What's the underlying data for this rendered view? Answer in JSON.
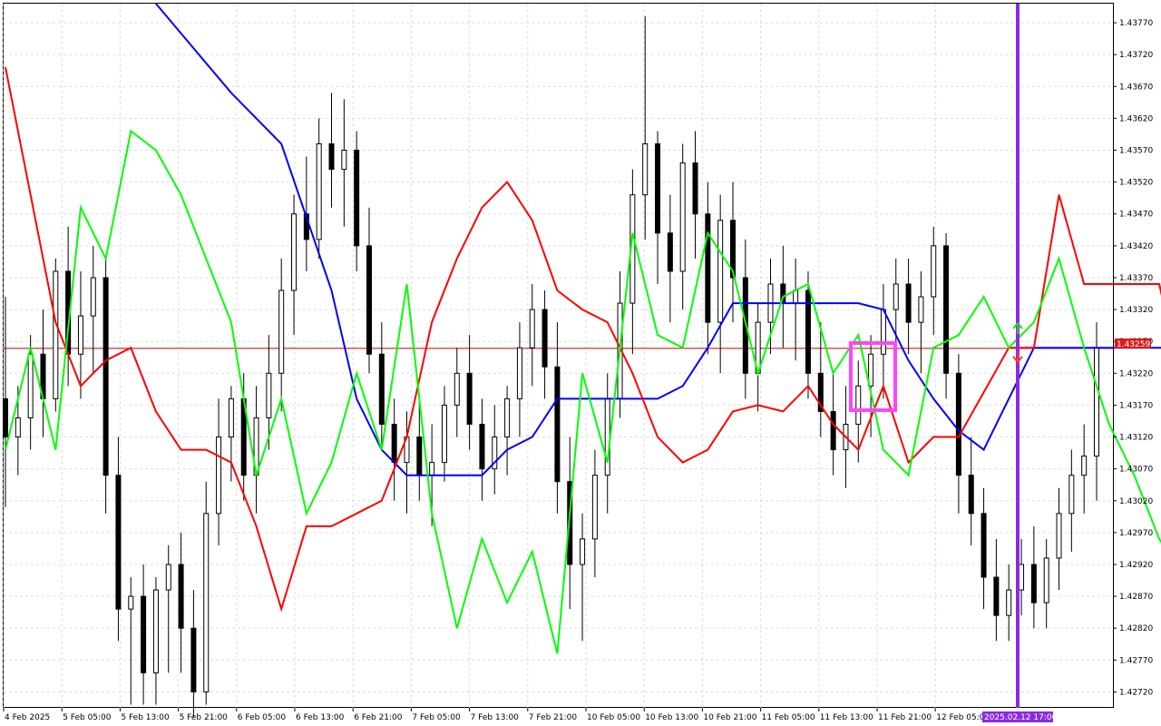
{
  "chart_data": {
    "type": "candlestick",
    "symbol_note": "",
    "y_axis": {
      "ticks": [
        "1.43770",
        "1.43720",
        "1.43670",
        "1.43620",
        "1.43570",
        "1.43520",
        "1.43470",
        "1.43420",
        "1.43370",
        "1.43320",
        "1.43270",
        "1.43220",
        "1.43170",
        "1.43120",
        "1.43070",
        "1.43020",
        "1.42970",
        "1.42920",
        "1.42870",
        "1.42820",
        "1.42770",
        "1.42720"
      ],
      "min": 1.42695,
      "max": 1.438
    },
    "x_axis": {
      "ticks": [
        "4 Feb 2025",
        "5 Feb 05:00",
        "5 Feb 13:00",
        "5 Feb 21:00",
        "6 Feb 05:00",
        "6 Feb 13:00",
        "6 Feb 21:00",
        "7 Feb 05:00",
        "7 Feb 13:00",
        "7 Feb 21:00",
        "10 Feb 05:00",
        "10 Feb 13:00",
        "10 Feb 21:00",
        "11 Feb 05:00",
        "11 Feb 13:00",
        "11 Feb 21:00",
        "12 Feb 05:00"
      ],
      "cursor_label": "2025.02.12 17:00"
    },
    "current_price": {
      "value": 1.43259,
      "label": "1.43259"
    },
    "candles": [
      [
        1.4318,
        1.4334,
        1.4301,
        1.4312
      ],
      [
        1.4312,
        1.432,
        1.4306,
        1.4315
      ],
      [
        1.4315,
        1.4328,
        1.431,
        1.4325
      ],
      [
        1.4325,
        1.4332,
        1.4312,
        1.4318
      ],
      [
        1.4318,
        1.434,
        1.4316,
        1.4338
      ],
      [
        1.4338,
        1.4345,
        1.432,
        1.4325
      ],
      [
        1.4325,
        1.4338,
        1.4318,
        1.4331
      ],
      [
        1.4331,
        1.4342,
        1.4322,
        1.4337
      ],
      [
        1.4337,
        1.434,
        1.43,
        1.4306
      ],
      [
        1.4306,
        1.4312,
        1.428,
        1.4285
      ],
      [
        1.4285,
        1.429,
        1.427,
        1.4287
      ],
      [
        1.4287,
        1.4292,
        1.427,
        1.4275
      ],
      [
        1.4275,
        1.429,
        1.427,
        1.4288
      ],
      [
        1.4288,
        1.4295,
        1.4275,
        1.4292
      ],
      [
        1.4292,
        1.4297,
        1.4275,
        1.4282
      ],
      [
        1.4282,
        1.4288,
        1.4268,
        1.4272
      ],
      [
        1.4272,
        1.4305,
        1.427,
        1.43
      ],
      [
        1.43,
        1.4318,
        1.4295,
        1.4312
      ],
      [
        1.4312,
        1.432,
        1.4305,
        1.4318
      ],
      [
        1.4318,
        1.4322,
        1.4302,
        1.4306
      ],
      [
        1.4306,
        1.432,
        1.43,
        1.4315
      ],
      [
        1.4315,
        1.4328,
        1.431,
        1.4322
      ],
      [
        1.4322,
        1.434,
        1.4316,
        1.4335
      ],
      [
        1.4335,
        1.435,
        1.4328,
        1.4347
      ],
      [
        1.4347,
        1.4356,
        1.4338,
        1.4343
      ],
      [
        1.4343,
        1.4362,
        1.434,
        1.4358
      ],
      [
        1.4358,
        1.4366,
        1.4348,
        1.4354
      ],
      [
        1.4354,
        1.4365,
        1.4345,
        1.4357
      ],
      [
        1.4357,
        1.436,
        1.4338,
        1.4342
      ],
      [
        1.4342,
        1.4348,
        1.4322,
        1.4325
      ],
      [
        1.4325,
        1.433,
        1.431,
        1.4314
      ],
      [
        1.4314,
        1.4318,
        1.4302,
        1.4308
      ],
      [
        1.4308,
        1.4316,
        1.43,
        1.4312
      ],
      [
        1.4312,
        1.4318,
        1.4302,
        1.4306
      ],
      [
        1.4306,
        1.4314,
        1.4298,
        1.4308
      ],
      [
        1.4308,
        1.432,
        1.4305,
        1.4317
      ],
      [
        1.4317,
        1.4326,
        1.4312,
        1.4322
      ],
      [
        1.4322,
        1.4328,
        1.431,
        1.4314
      ],
      [
        1.4314,
        1.4318,
        1.4302,
        1.4307
      ],
      [
        1.4307,
        1.4317,
        1.4303,
        1.4312
      ],
      [
        1.4312,
        1.432,
        1.4306,
        1.4318
      ],
      [
        1.4318,
        1.433,
        1.4312,
        1.4326
      ],
      [
        1.4326,
        1.4336,
        1.432,
        1.4332
      ],
      [
        1.4332,
        1.4335,
        1.4318,
        1.4323
      ],
      [
        1.4323,
        1.433,
        1.43,
        1.4305
      ],
      [
        1.4305,
        1.4312,
        1.4285,
        1.4292
      ],
      [
        1.4292,
        1.43,
        1.428,
        1.4296
      ],
      [
        1.4296,
        1.431,
        1.429,
        1.4306
      ],
      [
        1.4306,
        1.4322,
        1.43,
        1.4318
      ],
      [
        1.4318,
        1.4338,
        1.4315,
        1.4333
      ],
      [
        1.4333,
        1.4354,
        1.4325,
        1.435
      ],
      [
        1.435,
        1.4378,
        1.4343,
        1.4358
      ],
      [
        1.4358,
        1.436,
        1.4336,
        1.4344
      ],
      [
        1.4344,
        1.435,
        1.433,
        1.4338
      ],
      [
        1.4338,
        1.4358,
        1.4332,
        1.4355
      ],
      [
        1.4355,
        1.436,
        1.434,
        1.4347
      ],
      [
        1.4347,
        1.4352,
        1.4325,
        1.433
      ],
      [
        1.433,
        1.435,
        1.4322,
        1.4346
      ],
      [
        1.4346,
        1.4352,
        1.433,
        1.4337
      ],
      [
        1.4337,
        1.4343,
        1.4318,
        1.4322
      ],
      [
        1.4322,
        1.4333,
        1.4316,
        1.433
      ],
      [
        1.433,
        1.434,
        1.4325,
        1.4336
      ],
      [
        1.4336,
        1.4342,
        1.4326,
        1.4333
      ],
      [
        1.4333,
        1.434,
        1.4324,
        1.4335
      ],
      [
        1.4335,
        1.4338,
        1.4318,
        1.4322
      ],
      [
        1.4322,
        1.433,
        1.4312,
        1.4316
      ],
      [
        1.4316,
        1.4322,
        1.4306,
        1.431
      ],
      [
        1.431,
        1.432,
        1.4304,
        1.4314
      ],
      [
        1.4314,
        1.4324,
        1.4308,
        1.432
      ],
      [
        1.432,
        1.4328,
        1.4312,
        1.4325
      ],
      [
        1.4325,
        1.4336,
        1.4318,
        1.4332
      ],
      [
        1.4332,
        1.434,
        1.4326,
        1.4336
      ],
      [
        1.4336,
        1.434,
        1.4325,
        1.433
      ],
      [
        1.433,
        1.4338,
        1.4322,
        1.4334
      ],
      [
        1.4334,
        1.4345,
        1.4328,
        1.4342
      ],
      [
        1.4342,
        1.4344,
        1.4318,
        1.4322
      ],
      [
        1.4322,
        1.4325,
        1.43,
        1.4306
      ],
      [
        1.4306,
        1.4312,
        1.4295,
        1.43
      ],
      [
        1.43,
        1.4304,
        1.4285,
        1.429
      ],
      [
        1.429,
        1.4296,
        1.428,
        1.4284
      ],
      [
        1.4284,
        1.4292,
        1.428,
        1.4288
      ],
      [
        1.4288,
        1.4296,
        1.4284,
        1.4292
      ],
      [
        1.4292,
        1.4298,
        1.4282,
        1.4286
      ],
      [
        1.4286,
        1.4296,
        1.4282,
        1.4293
      ],
      [
        1.4293,
        1.4304,
        1.4288,
        1.43
      ],
      [
        1.43,
        1.431,
        1.4294,
        1.4306
      ],
      [
        1.4306,
        1.4314,
        1.43,
        1.4309
      ],
      [
        1.4309,
        1.433,
        1.4302,
        1.4326
      ]
    ],
    "lines": [
      {
        "color": "#0000ff",
        "points": [
          [
            12,
            1.438
          ],
          [
            18,
            1.4366
          ],
          [
            22,
            1.4358
          ],
          [
            26,
            1.4335
          ],
          [
            28,
            1.4318
          ],
          [
            30,
            1.431
          ],
          [
            32,
            1.4306
          ],
          [
            34,
            1.4306
          ],
          [
            36,
            1.4306
          ],
          [
            38,
            1.4306
          ],
          [
            40,
            1.431
          ],
          [
            42,
            1.4312
          ],
          [
            44,
            1.4318
          ],
          [
            46,
            1.4318
          ],
          [
            48,
            1.4318
          ],
          [
            50,
            1.4318
          ],
          [
            52,
            1.4318
          ],
          [
            54,
            1.432
          ],
          [
            56,
            1.4326
          ],
          [
            58,
            1.4333
          ],
          [
            60,
            1.4333
          ],
          [
            62,
            1.4333
          ],
          [
            64,
            1.4333
          ],
          [
            66,
            1.4333
          ],
          [
            68,
            1.4333
          ],
          [
            70,
            1.4332
          ],
          [
            72,
            1.4324
          ],
          [
            74,
            1.4318
          ],
          [
            76,
            1.4313
          ],
          [
            78,
            1.431
          ],
          [
            80,
            1.4318
          ],
          [
            82,
            1.4326
          ],
          [
            84,
            1.4326
          ],
          [
            86,
            1.4326
          ],
          [
            88,
            1.4326
          ],
          [
            90,
            1.4326
          ],
          [
            92,
            1.4326
          ],
          [
            94,
            1.4326
          ],
          [
            96,
            1.4326
          ],
          [
            98,
            1.4326
          ],
          [
            100,
            1.434
          ],
          [
            102,
            1.4332
          ],
          [
            104,
            1.4332
          ],
          [
            106,
            1.4332
          ],
          [
            108,
            1.4332
          ],
          [
            110,
            1.4325
          ],
          [
            112,
            1.4325
          ],
          [
            114,
            1.4325
          ],
          [
            116,
            1.4322
          ],
          [
            118,
            1.4315
          ],
          [
            120,
            1.4312
          ],
          [
            122,
            1.4312
          ],
          [
            124,
            1.4312
          ],
          [
            126,
            1.4312
          ],
          [
            128,
            1.4312
          ],
          [
            130,
            1.4312
          ],
          [
            132,
            1.4312
          ],
          [
            134,
            1.4312
          ],
          [
            136,
            1.431
          ]
        ]
      },
      {
        "color": "#ff0000",
        "points": [
          [
            0,
            1.437
          ],
          [
            2,
            1.435
          ],
          [
            4,
            1.433
          ],
          [
            6,
            1.432
          ],
          [
            8,
            1.4324
          ],
          [
            10,
            1.4326
          ],
          [
            12,
            1.4316
          ],
          [
            14,
            1.431
          ],
          [
            16,
            1.431
          ],
          [
            18,
            1.4308
          ],
          [
            20,
            1.4298
          ],
          [
            22,
            1.4285
          ],
          [
            24,
            1.4298
          ],
          [
            26,
            1.4298
          ],
          [
            28,
            1.43
          ],
          [
            30,
            1.4302
          ],
          [
            32,
            1.4312
          ],
          [
            34,
            1.433
          ],
          [
            36,
            1.434
          ],
          [
            38,
            1.4348
          ],
          [
            40,
            1.4352
          ],
          [
            42,
            1.4346
          ],
          [
            44,
            1.4335
          ],
          [
            46,
            1.4332
          ],
          [
            48,
            1.433
          ],
          [
            50,
            1.4322
          ],
          [
            52,
            1.4312
          ],
          [
            54,
            1.4308
          ],
          [
            56,
            1.431
          ],
          [
            58,
            1.4316
          ],
          [
            60,
            1.4317
          ],
          [
            62,
            1.4316
          ],
          [
            64,
            1.432
          ],
          [
            66,
            1.4314
          ],
          [
            68,
            1.431
          ],
          [
            70,
            1.432
          ],
          [
            72,
            1.4308
          ],
          [
            74,
            1.4312
          ],
          [
            76,
            1.4312
          ],
          [
            80,
            1.4326
          ],
          [
            82,
            1.4326
          ],
          [
            84,
            1.435
          ],
          [
            86,
            1.4336
          ],
          [
            88,
            1.4336
          ],
          [
            90,
            1.4336
          ],
          [
            92,
            1.4336
          ],
          [
            94,
            1.4318
          ],
          [
            96,
            1.4328
          ],
          [
            98,
            1.4324
          ],
          [
            100,
            1.4322
          ],
          [
            102,
            1.4322
          ],
          [
            104,
            1.4322
          ],
          [
            106,
            1.4324
          ],
          [
            108,
            1.4334
          ],
          [
            110,
            1.4333
          ],
          [
            112,
            1.4324
          ],
          [
            114,
            1.4325
          ],
          [
            116,
            1.4318
          ],
          [
            118,
            1.431
          ],
          [
            120,
            1.4302
          ],
          [
            122,
            1.4296
          ],
          [
            124,
            1.4292
          ],
          [
            126,
            1.4288
          ],
          [
            128,
            1.4289
          ],
          [
            130,
            1.429
          ],
          [
            132,
            1.4296
          ],
          [
            134,
            1.4302
          ],
          [
            136,
            1.4308
          ]
        ]
      },
      {
        "color": "#00ff00",
        "points": [
          [
            0,
            1.431
          ],
          [
            2,
            1.4326
          ],
          [
            4,
            1.431
          ],
          [
            6,
            1.4348
          ],
          [
            8,
            1.434
          ],
          [
            10,
            1.436
          ],
          [
            12,
            1.4357
          ],
          [
            14,
            1.435
          ],
          [
            16,
            1.434
          ],
          [
            18,
            1.433
          ],
          [
            20,
            1.4306
          ],
          [
            22,
            1.4318
          ],
          [
            24,
            1.43
          ],
          [
            26,
            1.4308
          ],
          [
            28,
            1.4322
          ],
          [
            30,
            1.431
          ],
          [
            32,
            1.4336
          ],
          [
            34,
            1.43
          ],
          [
            36,
            1.4282
          ],
          [
            38,
            1.4296
          ],
          [
            40,
            1.4286
          ],
          [
            42,
            1.4294
          ],
          [
            44,
            1.4278
          ],
          [
            46,
            1.4322
          ],
          [
            48,
            1.4308
          ],
          [
            50,
            1.4344
          ],
          [
            52,
            1.4328
          ],
          [
            54,
            1.4326
          ],
          [
            56,
            1.4344
          ],
          [
            58,
            1.4338
          ],
          [
            60,
            1.4322
          ],
          [
            62,
            1.4334
          ],
          [
            64,
            1.4336
          ],
          [
            66,
            1.4322
          ],
          [
            68,
            1.4328
          ],
          [
            70,
            1.431
          ],
          [
            72,
            1.4306
          ],
          [
            74,
            1.4326
          ],
          [
            76,
            1.4328
          ],
          [
            78,
            1.4334
          ],
          [
            80,
            1.4326
          ],
          [
            82,
            1.433
          ],
          [
            84,
            1.434
          ],
          [
            86,
            1.4326
          ],
          [
            88,
            1.4314
          ],
          [
            90,
            1.4306
          ],
          [
            92,
            1.4296
          ],
          [
            94,
            1.429
          ],
          [
            96,
            1.428
          ],
          [
            98,
            1.4286
          ],
          [
            100,
            1.428
          ],
          [
            102,
            1.4292
          ],
          [
            104,
            1.4288
          ],
          [
            106,
            1.4296
          ],
          [
            108,
            1.4302
          ],
          [
            110,
            1.4294
          ],
          [
            112,
            1.432
          ]
        ]
      }
    ]
  }
}
